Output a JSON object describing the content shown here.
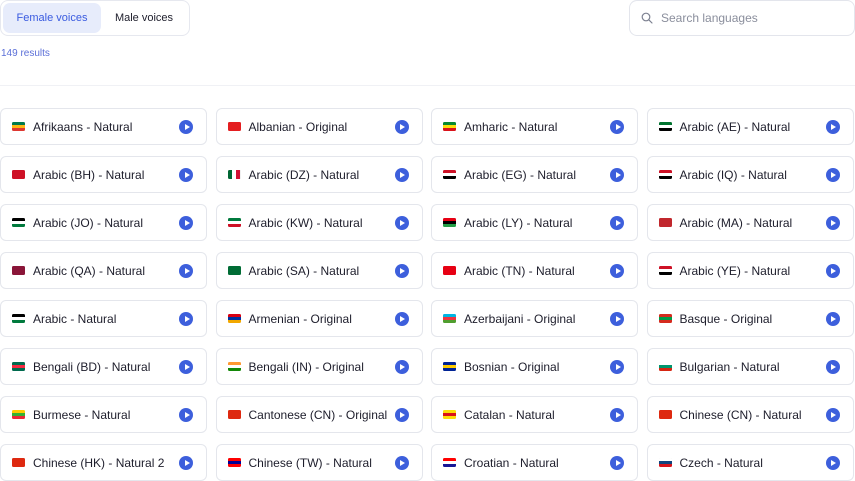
{
  "tabs": {
    "female": "Female voices",
    "male": "Male voices"
  },
  "search": {
    "placeholder": "Search languages"
  },
  "results": "149 results",
  "languages": [
    {
      "label": "Afrikaans - Natural",
      "flag": [
        "#007a4d",
        "#ffb612",
        "#de3831"
      ]
    },
    {
      "label": "Albanian - Original",
      "flag": [
        "#e41e20",
        "#e41e20",
        "#e41e20"
      ]
    },
    {
      "label": "Amharic - Natural",
      "flag": [
        "#078930",
        "#fcdd09",
        "#da121a"
      ]
    },
    {
      "label": "Arabic (AE) - Natural",
      "flag": [
        "#00732f",
        "#ffffff",
        "#000000"
      ]
    },
    {
      "label": "Arabic (BH) - Natural",
      "flag": [
        "#ce1126",
        "#ce1126",
        "#ce1126"
      ]
    },
    {
      "label": "Arabic (DZ) - Natural",
      "flag": [
        "#006633",
        "#ffffff",
        "#d21034"
      ],
      "vertical": true
    },
    {
      "label": "Arabic (EG) - Natural",
      "flag": [
        "#ce1126",
        "#ffffff",
        "#000000"
      ]
    },
    {
      "label": "Arabic (IQ) - Natural",
      "flag": [
        "#ce1126",
        "#ffffff",
        "#000000"
      ]
    },
    {
      "label": "Arabic (JO) - Natural",
      "flag": [
        "#000000",
        "#ffffff",
        "#007a3d"
      ]
    },
    {
      "label": "Arabic (KW) - Natural",
      "flag": [
        "#007a3d",
        "#ffffff",
        "#ce1126"
      ]
    },
    {
      "label": "Arabic (LY) - Natural",
      "flag": [
        "#e70013",
        "#000000",
        "#239e46"
      ]
    },
    {
      "label": "Arabic (MA) - Natural",
      "flag": [
        "#c1272d",
        "#c1272d",
        "#c1272d"
      ]
    },
    {
      "label": "Arabic (QA) - Natural",
      "flag": [
        "#8a1538",
        "#8a1538",
        "#8a1538"
      ]
    },
    {
      "label": "Arabic (SA) - Natural",
      "flag": [
        "#006c35",
        "#006c35",
        "#006c35"
      ]
    },
    {
      "label": "Arabic (TN) - Natural",
      "flag": [
        "#e70013",
        "#e70013",
        "#e70013"
      ]
    },
    {
      "label": "Arabic (YE) - Natural",
      "flag": [
        "#ce1126",
        "#ffffff",
        "#000000"
      ]
    },
    {
      "label": "Arabic - Natural",
      "flag": [
        "#000000",
        "#ffffff",
        "#007a3d"
      ]
    },
    {
      "label": "Armenian - Original",
      "flag": [
        "#d90012",
        "#0033a0",
        "#f2a800"
      ]
    },
    {
      "label": "Azerbaijani - Original",
      "flag": [
        "#00b5e2",
        "#ef3340",
        "#509e2f"
      ]
    },
    {
      "label": "Basque - Original",
      "flag": [
        "#d52b1e",
        "#009b48",
        "#d52b1e"
      ]
    },
    {
      "label": "Bengali (BD) - Natural",
      "flag": [
        "#006a4e",
        "#f42a41",
        "#006a4e"
      ]
    },
    {
      "label": "Bengali (IN) - Original",
      "flag": [
        "#ff9933",
        "#ffffff",
        "#138808"
      ]
    },
    {
      "label": "Bosnian - Original",
      "flag": [
        "#002395",
        "#fecb00",
        "#002395"
      ]
    },
    {
      "label": "Bulgarian - Natural",
      "flag": [
        "#ffffff",
        "#00966e",
        "#d62612"
      ]
    },
    {
      "label": "Burmese - Natural",
      "flag": [
        "#fecb00",
        "#34b233",
        "#ea2839"
      ]
    },
    {
      "label": "Cantonese (CN) - Original",
      "flag": [
        "#de2910",
        "#de2910",
        "#de2910"
      ]
    },
    {
      "label": "Catalan - Natural",
      "flag": [
        "#fcdd09",
        "#da121a",
        "#fcdd09"
      ]
    },
    {
      "label": "Chinese (CN) - Natural",
      "flag": [
        "#de2910",
        "#de2910",
        "#de2910"
      ]
    },
    {
      "label": "Chinese (HK) - Natural 2",
      "flag": [
        "#de2910",
        "#de2910",
        "#de2910"
      ]
    },
    {
      "label": "Chinese (TW) - Natural",
      "flag": [
        "#fe0000",
        "#000095",
        "#fe0000"
      ]
    },
    {
      "label": "Croatian - Natural",
      "flag": [
        "#ff0000",
        "#ffffff",
        "#171796"
      ]
    },
    {
      "label": "Czech - Natural",
      "flag": [
        "#ffffff",
        "#11457e",
        "#d7141a"
      ]
    }
  ]
}
